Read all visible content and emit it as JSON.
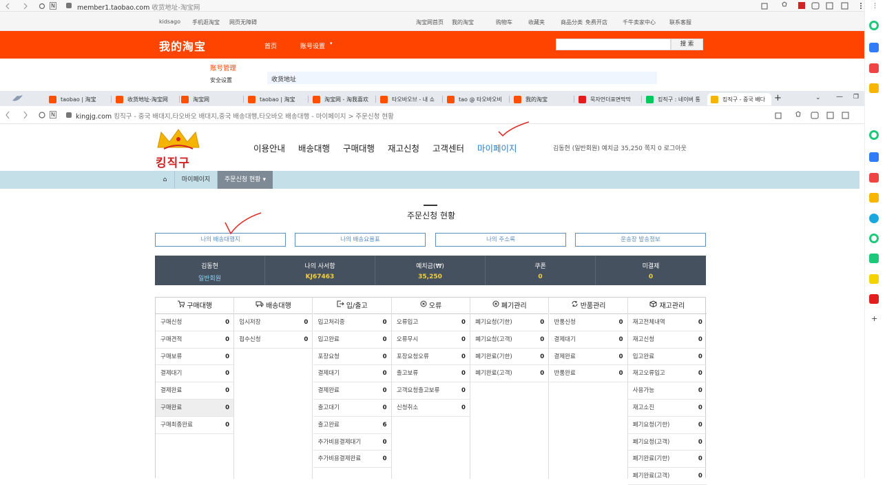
{
  "win1": {
    "url": "member1.taobao.com",
    "url_title": "收货地址-淘宝网",
    "topnav": [
      "kidsago",
      "手机逛淘宝",
      "网页无障碍",
      "淘宝网首页",
      "我的淘宝",
      "购物车",
      "收藏夹",
      "商品分类",
      "免费开店",
      "千牛卖家中心",
      "联系客服"
    ],
    "logo": "我的淘宝",
    "nav_home": "首页",
    "nav_account": "账号设置",
    "search_btn": "搜 索",
    "side_title": "账号管理",
    "side_item": "安全设置",
    "address_label": "收货地址"
  },
  "tabs": [
    {
      "label": "taobao | 淘宝",
      "color": "#ff5000"
    },
    {
      "label": "收货地址-淘宝网",
      "color": "#ff5000"
    },
    {
      "label": "淘宝网",
      "color": "#ff5000"
    },
    {
      "label": "taobao | 淘宝",
      "color": "#ff5000"
    },
    {
      "label": "淘宝网 - 淘我喜欢",
      "color": "#ff5000"
    },
    {
      "label": "타오바오브 - 내 쇼",
      "color": "#ff5000"
    },
    {
      "label": "tao @ 타오바오비",
      "color": "#ff5000"
    },
    {
      "label": "我的淘宝",
      "color": "#ff5000"
    },
    {
      "label": "묵자언더표면막막",
      "color": "#e11d1d"
    },
    {
      "label": "킹직구 : 네이버 통",
      "color": "#03c75a"
    },
    {
      "label": "킹직구 - 중국 배다",
      "color": "#f5b400"
    }
  ],
  "addr2": {
    "url": "kingjg.com",
    "title": "킹직구 - 중국 배대지,타오바오 배대지,중국 배송대행,타오바오 배송대행 - 마이페이지 > 주문신청 현황"
  },
  "site": {
    "logo_text": "킹직구",
    "nav": [
      "이용안내",
      "배송대행",
      "구매대행",
      "재고신청",
      "고객센터",
      "마이페이지"
    ],
    "user_info": "김동현 (일반회원)  예치금 35,250  쪽지 0  로그아웃",
    "crumbs": [
      "마이페이지",
      "주문신청 현황"
    ],
    "page_title": "주문신청 현황",
    "tab_buttons": [
      "나의 배송대행지",
      "나의 배송요율표",
      "나의 주소록",
      "운송장 발송정보"
    ],
    "summary": [
      {
        "h": "김동현",
        "v": "일반회원"
      },
      {
        "h": "나의 사서함",
        "v": "KJ67463"
      },
      {
        "h": "예치금(₩)",
        "v": "35,250"
      },
      {
        "h": "쿠폰",
        "v": "0"
      },
      {
        "h": "미결제",
        "v": "0"
      }
    ],
    "columns": [
      {
        "title": "구매대행",
        "icon": "cart-icon",
        "rows": [
          [
            "구매신청",
            "0"
          ],
          [
            "구매견적",
            "0"
          ],
          [
            "구매보류",
            "0"
          ],
          [
            "결제대기",
            "0"
          ],
          [
            "결제완료",
            "0"
          ],
          [
            "구매완료",
            "0"
          ],
          [
            "구매최종완료",
            "0"
          ]
        ]
      },
      {
        "title": "배송대행",
        "icon": "truck-icon",
        "rows": [
          [
            "임시저장",
            "0"
          ],
          [
            "접수신청",
            "0"
          ]
        ]
      },
      {
        "title": "입/출고",
        "icon": "exit-icon",
        "rows": [
          [
            "입고처리중",
            "0"
          ],
          [
            "입고완료",
            "0"
          ],
          [
            "포장요청",
            "0"
          ],
          [
            "결제대기",
            "0"
          ],
          [
            "결제완료",
            "0"
          ],
          [
            "출고대기",
            "0"
          ],
          [
            "출고완료",
            "6"
          ],
          [
            "추가비용결제대기",
            "0"
          ],
          [
            "추가비용결제완료",
            "0"
          ]
        ]
      },
      {
        "title": "오류",
        "icon": "error-icon",
        "rows": [
          [
            "오류입고",
            "0"
          ],
          [
            "오류무시",
            "0"
          ],
          [
            "포장요청오류",
            "0"
          ],
          [
            "출고보류",
            "0"
          ],
          [
            "고객요청출고보류",
            "0"
          ],
          [
            "신청취소",
            "0"
          ]
        ]
      },
      {
        "title": "폐기관리",
        "icon": "dispose-icon",
        "rows": [
          [
            "폐기요청(기한)",
            "0"
          ],
          [
            "폐기요청(고객)",
            "0"
          ],
          [
            "폐기완료(기한)",
            "0"
          ],
          [
            "폐기완료(고객)",
            "0"
          ]
        ]
      },
      {
        "title": "반품관리",
        "icon": "refresh-icon",
        "rows": [
          [
            "반품신청",
            "0"
          ],
          [
            "결제대기",
            "0"
          ],
          [
            "결제완료",
            "0"
          ],
          [
            "반품완료",
            "0"
          ]
        ]
      },
      {
        "title": "재고관리",
        "icon": "box-icon",
        "rows": [
          [
            "재고전체내역",
            "0"
          ],
          [
            "재고신청",
            "0"
          ],
          [
            "입고완료",
            "0"
          ],
          [
            "재고오류입고",
            "0"
          ],
          [
            "사용가능",
            "0"
          ],
          [
            "재고소진",
            "0"
          ],
          [
            "폐기요청(기한)",
            "0"
          ],
          [
            "폐기요청(고객)",
            "0"
          ],
          [
            "폐기완료(기한)",
            "0"
          ],
          [
            "폐기완료(고객)",
            "0"
          ]
        ]
      }
    ]
  }
}
